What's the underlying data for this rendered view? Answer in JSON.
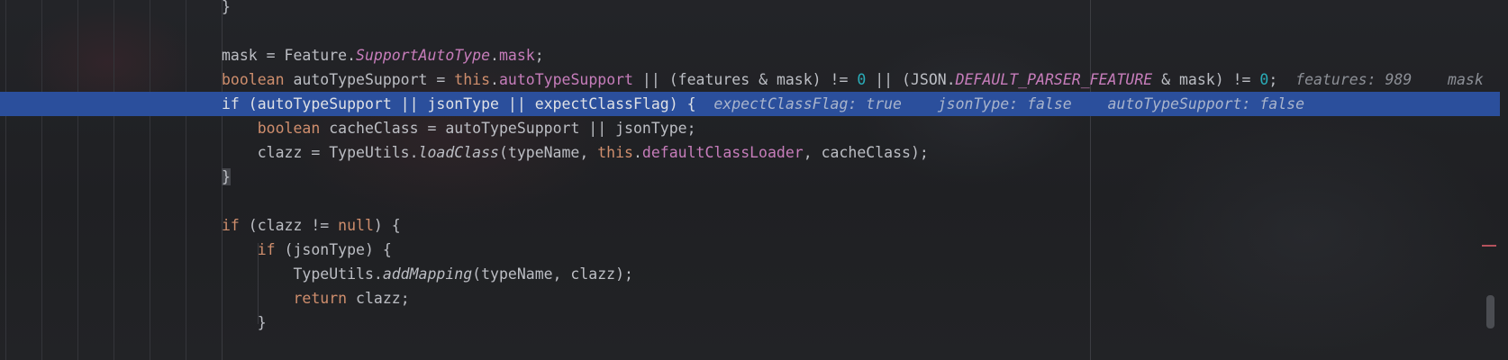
{
  "editor": {
    "lines": [
      {
        "id": "l0",
        "tokens": [
          {
            "t": "}",
            "c": ""
          }
        ]
      },
      {
        "id": "l1",
        "tokens": []
      },
      {
        "id": "l2",
        "tokens": [
          {
            "t": "mask = Feature.",
            "c": ""
          },
          {
            "t": "SupportAutoType",
            "c": "cls-it"
          },
          {
            "t": ".",
            "c": ""
          },
          {
            "t": "mask",
            "c": "fld"
          },
          {
            "t": ";",
            "c": ""
          }
        ]
      },
      {
        "id": "l3",
        "tokens": [
          {
            "t": "boolean",
            "c": "kw"
          },
          {
            "t": " autoTypeSupport = ",
            "c": ""
          },
          {
            "t": "this",
            "c": "kw"
          },
          {
            "t": ".",
            "c": ""
          },
          {
            "t": "autoTypeSupport",
            "c": "fld"
          },
          {
            "t": " || (features & mask) != ",
            "c": ""
          },
          {
            "t": "0",
            "c": "num"
          },
          {
            "t": " || (JSON.",
            "c": ""
          },
          {
            "t": "DEFAULT_PARSER_FEATURE",
            "c": "cst"
          },
          {
            "t": " & mask) != ",
            "c": ""
          },
          {
            "t": "0",
            "c": "num"
          },
          {
            "t": ";",
            "c": ""
          },
          {
            "t": "  features: 989    mask",
            "c": "hint"
          }
        ]
      },
      {
        "id": "l4",
        "selected": true,
        "tokens": [
          {
            "t": "if",
            "c": "kw"
          },
          {
            "t": " (autoTypeSupport || jsonType || expectClassFlag) ",
            "c": ""
          },
          {
            "t": "{",
            "c": "brace-hl"
          },
          {
            "t": "  expectClassFlag: true    jsonType: false    autoTypeSupport: false",
            "c": "hint"
          }
        ]
      },
      {
        "id": "l5",
        "tokens": [
          {
            "t": "    ",
            "c": ""
          },
          {
            "t": "boolean",
            "c": "kw"
          },
          {
            "t": " cacheClass = autoTypeSupport || jsonType;",
            "c": ""
          }
        ]
      },
      {
        "id": "l6",
        "tokens": [
          {
            "t": "    clazz = TypeUtils.",
            "c": ""
          },
          {
            "t": "loadClass",
            "c": "mth"
          },
          {
            "t": "(typeName, ",
            "c": ""
          },
          {
            "t": "this",
            "c": "kw"
          },
          {
            "t": ".",
            "c": ""
          },
          {
            "t": "defaultClassLoader",
            "c": "fld"
          },
          {
            "t": ", cacheClass);",
            "c": ""
          }
        ]
      },
      {
        "id": "l7",
        "tokens": [
          {
            "t": "}",
            "c": "brace-hl"
          }
        ]
      },
      {
        "id": "l8",
        "tokens": []
      },
      {
        "id": "l9",
        "tokens": [
          {
            "t": "if",
            "c": "kw"
          },
          {
            "t": " (clazz != ",
            "c": ""
          },
          {
            "t": "null",
            "c": "kw"
          },
          {
            "t": ") {",
            "c": ""
          }
        ]
      },
      {
        "id": "l10",
        "tokens": [
          {
            "t": "    ",
            "c": ""
          },
          {
            "t": "if",
            "c": "kw"
          },
          {
            "t": " (jsonType) {",
            "c": ""
          }
        ]
      },
      {
        "id": "l11",
        "tokens": [
          {
            "t": "        TypeUtils.",
            "c": ""
          },
          {
            "t": "addMapping",
            "c": "mth"
          },
          {
            "t": "(typeName, clazz);",
            "c": ""
          }
        ]
      },
      {
        "id": "l12",
        "tokens": [
          {
            "t": "        ",
            "c": ""
          },
          {
            "t": "return",
            "c": "kw"
          },
          {
            "t": " clazz;",
            "c": ""
          }
        ]
      },
      {
        "id": "l13",
        "tokens": [
          {
            "t": "    }",
            "c": ""
          }
        ]
      },
      {
        "id": "l14",
        "tokens": []
      }
    ]
  },
  "colors": {
    "selection": "#2b4f9c",
    "keyword": "#cf8e6d",
    "field": "#c77dbb",
    "number": "#2aacb8",
    "hint": "#8c8f96",
    "error_mark": "#b4525c"
  }
}
